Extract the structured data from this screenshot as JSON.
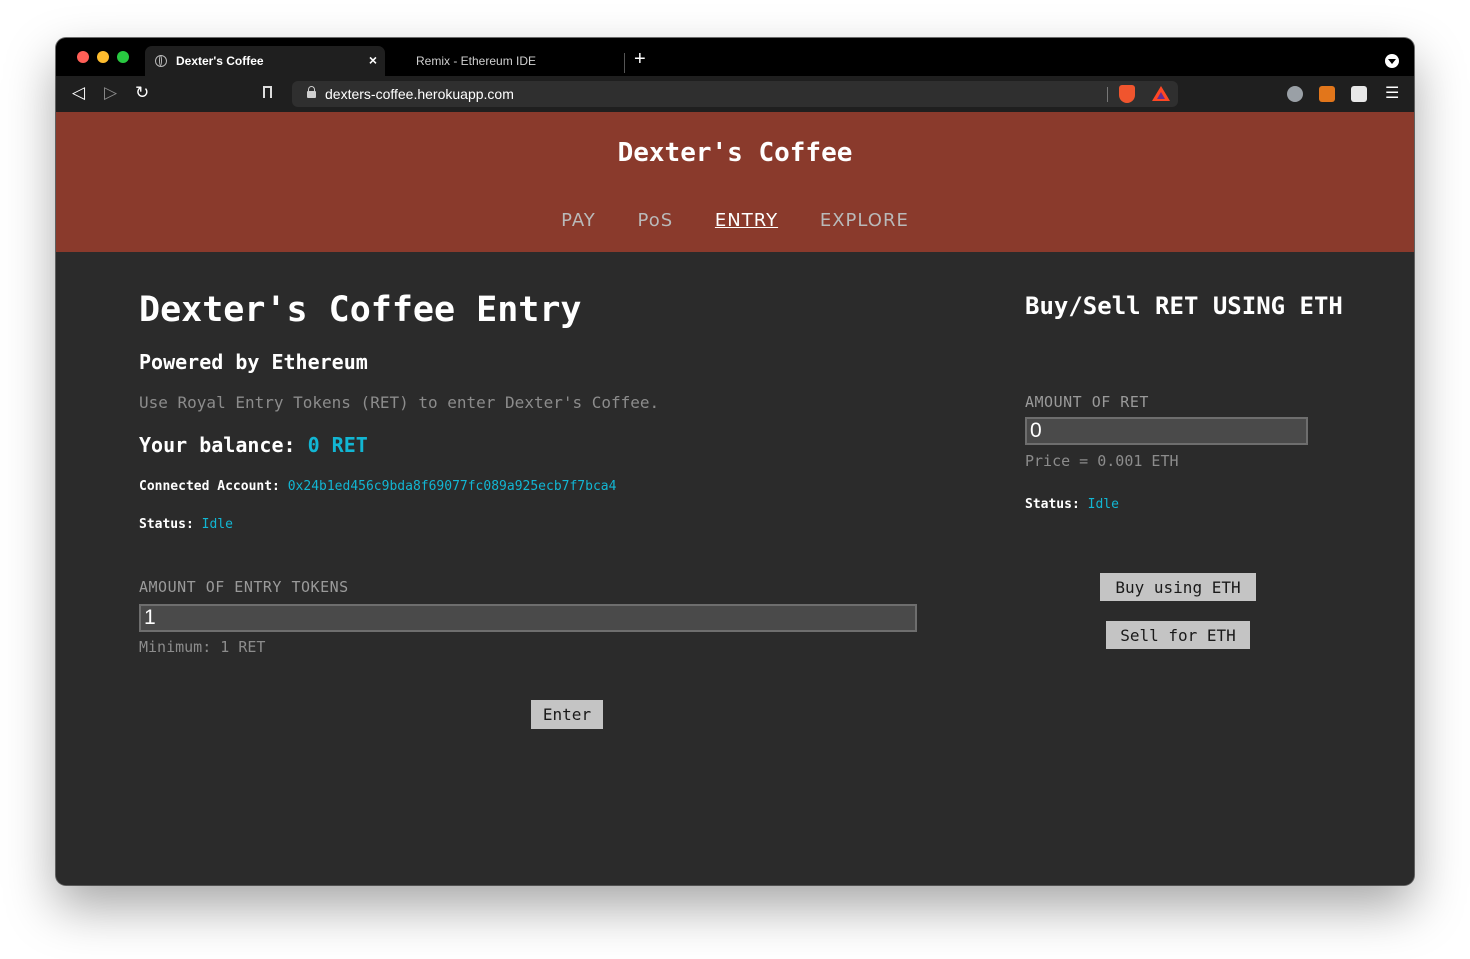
{
  "browser": {
    "tabs": [
      {
        "label": "Dexter's Coffee",
        "active": true
      },
      {
        "label": "Remix - Ethereum IDE",
        "active": false
      }
    ],
    "new_tab": "+",
    "tab_close": "×",
    "url": "dexters-coffee.herokuapp.com",
    "menu_icon": "☰"
  },
  "site": {
    "title": "Dexter's Coffee",
    "nav": [
      {
        "label": "PAY",
        "active": false
      },
      {
        "label": "PoS",
        "active": false
      },
      {
        "label": "ENTRY",
        "active": true
      },
      {
        "label": "EXPLORE",
        "active": false
      }
    ]
  },
  "entry": {
    "title": "Dexter's Coffee Entry",
    "subtitle": "Powered by Ethereum",
    "description": "Use Royal Entry Tokens (RET) to enter Dexter's Coffee.",
    "balance_label": "Your balance:",
    "balance_value": "0 RET",
    "account_label": "Connected Account:",
    "account_value": "0x24b1ed456c9bda8f69077fc089a925ecb7f7bca4",
    "status_label": "Status:",
    "status_value": "Idle",
    "tokens_label": "AMOUNT OF ENTRY TOKENS",
    "tokens_value": "1",
    "tokens_hint": "Minimum: 1 RET",
    "enter_button": "Enter"
  },
  "exchange": {
    "title": "Buy/Sell RET USING ETH",
    "amount_label": "AMOUNT OF RET",
    "amount_value": "0",
    "price": "Price = 0.001 ETH",
    "status_label": "Status:",
    "status_value": "Idle",
    "buy_button": "Buy using ETH",
    "sell_button": "Sell for ETH"
  },
  "colors": {
    "header": "#8a3a2c",
    "background": "#2b2b2b",
    "accent": "#12b6d3",
    "button": "#c4c4c4"
  }
}
